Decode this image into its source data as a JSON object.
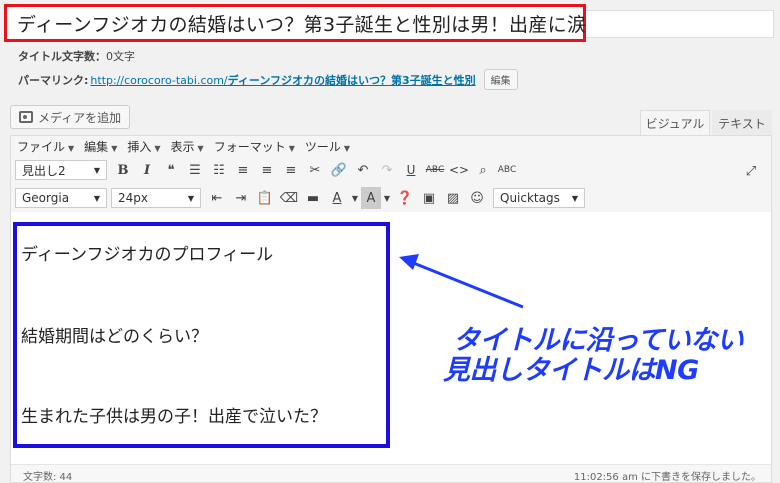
{
  "post_title": "ディーンフジオカの結婚はいつ？第3子誕生と性別は男！出産に涙？",
  "meta": {
    "char_count_label": "タイトル文字数：",
    "char_count_value": "0文字",
    "permalink_label": "パーマリンク:",
    "permalink_base": "http://corocoro-tabi.com/",
    "permalink_slug": "ディーンフジオカの結婚はいつ？第3子誕生と性別",
    "edit_button": "編集"
  },
  "media_button": "メディアを追加",
  "tabs": {
    "visual": "ビジュアル",
    "text": "テキスト"
  },
  "menubar": [
    "ファイル",
    "編集",
    "挿入",
    "表示",
    "フォーマット",
    "ツール"
  ],
  "toolbar": {
    "format_select": "見出し2",
    "font_select": "Georgia",
    "size_select": "24px",
    "quicktags_select": "Quicktags"
  },
  "headings": [
    "ディーンフジオカのプロフィール",
    "結婚期間はどのくらい？",
    "生まれた子供は男の子！出産で泣いた？"
  ],
  "annotation": {
    "line1": "タイトルに沿っていない",
    "line2": "見出しタイトルはNG"
  },
  "status": {
    "word_count": "文字数: 44",
    "saved": "11:02:56 am に下書きを保存しました。"
  },
  "colors": {
    "title_highlight": "#e8121b",
    "content_highlight": "#1a0ee0",
    "annotation": "#1e3cff"
  }
}
